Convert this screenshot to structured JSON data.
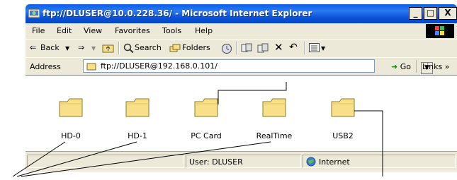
{
  "window": {
    "title": "ftp://DLUSER@10.0.228.36/ - Microsoft Internet Explorer",
    "buttons": [
      "_",
      "□",
      "X"
    ]
  },
  "menubar": {
    "items": [
      "File",
      "Edit",
      "View",
      "Favorites",
      "Tools",
      "Help"
    ]
  },
  "toolbar": {
    "back_label": "Back",
    "search_label": "Search",
    "folders_label": "Folders"
  },
  "address": {
    "label": "Address",
    "value": "ftp://DLUSER@192.168.0.101/",
    "go_label": "Go",
    "links_label": "Links »"
  },
  "folders": [
    {
      "name": "HD-0"
    },
    {
      "name": "HD-1"
    },
    {
      "name": "PC Card"
    },
    {
      "name": "RealTime"
    },
    {
      "name": "USB2"
    }
  ],
  "statusbar": {
    "user": "User: DLUSER",
    "zone": "Internet"
  },
  "colors": {
    "titlebar": "#0a5ee8",
    "folder": "#f8e08a",
    "chrome": "#ece9d8"
  }
}
